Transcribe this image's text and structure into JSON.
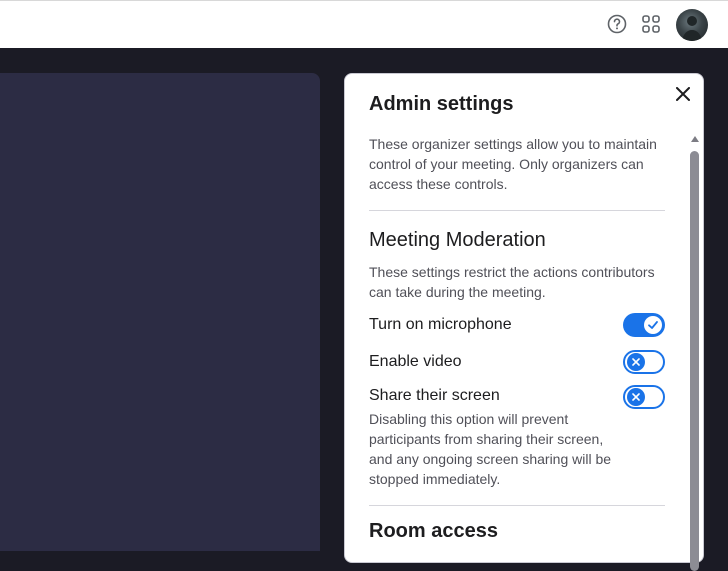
{
  "topbar": {
    "help_icon": "help-circle-icon",
    "apps_icon": "apps-grid-icon"
  },
  "panel": {
    "title": "Admin settings",
    "intro": "These organizer settings allow you to maintain control of your meeting. Only organizers can access these controls.",
    "section": {
      "heading": "Meeting Moderation",
      "description": "These settings restrict the actions contributors can take during the meeting.",
      "options": [
        {
          "label": "Turn on microphone",
          "state": "on"
        },
        {
          "label": "Enable video",
          "state": "off"
        },
        {
          "label": "Share their screen",
          "state": "off",
          "note": "Disabling this option will prevent participants from sharing their screen, and any ongoing screen sharing will be stopped immediately."
        }
      ]
    },
    "next_heading": "Room access"
  },
  "colors": {
    "accent": "#1a73e8",
    "video_bg": "#2c2c44",
    "page_bg": "#1b1b25"
  }
}
